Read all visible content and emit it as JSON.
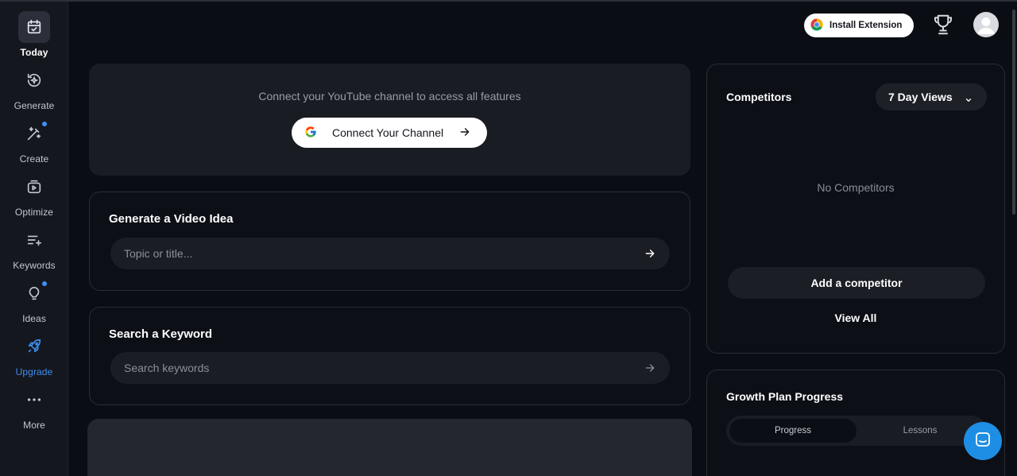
{
  "sidebar": {
    "items": [
      {
        "label": "Today",
        "icon": "calendar-check-icon"
      },
      {
        "label": "Generate",
        "icon": "sparkle-refresh-icon"
      },
      {
        "label": "Create",
        "icon": "magic-wand-icon"
      },
      {
        "label": "Optimize",
        "icon": "video-refresh-icon"
      },
      {
        "label": "Keywords",
        "icon": "list-plus-icon"
      },
      {
        "label": "Ideas",
        "icon": "lightbulb-icon"
      },
      {
        "label": "Upgrade",
        "icon": "rocket-icon"
      },
      {
        "label": "More",
        "icon": "more-dots-icon"
      }
    ]
  },
  "header": {
    "install_label": "Install Extension"
  },
  "connect": {
    "text": "Connect your YouTube channel to access all features",
    "button_label": "Connect Your Channel"
  },
  "video_idea": {
    "title": "Generate a Video Idea",
    "placeholder": "Topic or title..."
  },
  "keyword": {
    "title": "Search a Keyword",
    "placeholder": "Search keywords"
  },
  "competitors": {
    "title": "Competitors",
    "filter_label": "7 Day Views",
    "empty_text": "No Competitors",
    "add_label": "Add a competitor",
    "view_all_label": "View All"
  },
  "growth_plan": {
    "title": "Growth Plan Progress",
    "tabs": [
      "Progress",
      "Lessons"
    ],
    "active_tab": "Progress"
  },
  "colors": {
    "background": "#0b0d14",
    "sidebar": "#15171e",
    "accent_blue": "#3b8ff0",
    "chat_blue": "#1e8ee4"
  }
}
